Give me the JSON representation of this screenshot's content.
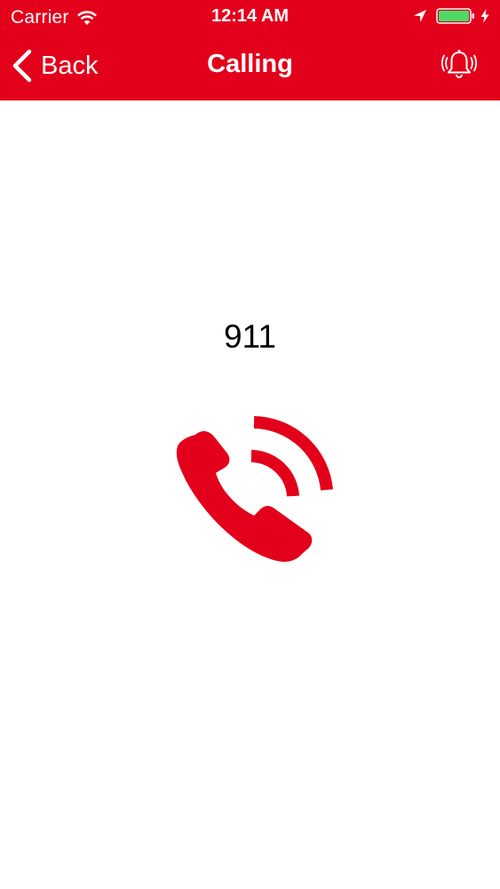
{
  "status_bar": {
    "carrier": "Carrier",
    "time": "12:14 AM",
    "icons": [
      "wifi-icon",
      "location-icon",
      "battery-icon",
      "charge-icon"
    ]
  },
  "nav": {
    "back_label": "Back",
    "title": "Calling",
    "right_icon": "bell-icon"
  },
  "call": {
    "number": "911",
    "icon": "phone-calling-icon"
  },
  "colors": {
    "brand": "#e3001b",
    "background": "#ffffff",
    "battery": "#4cd964",
    "text": "#000000"
  }
}
